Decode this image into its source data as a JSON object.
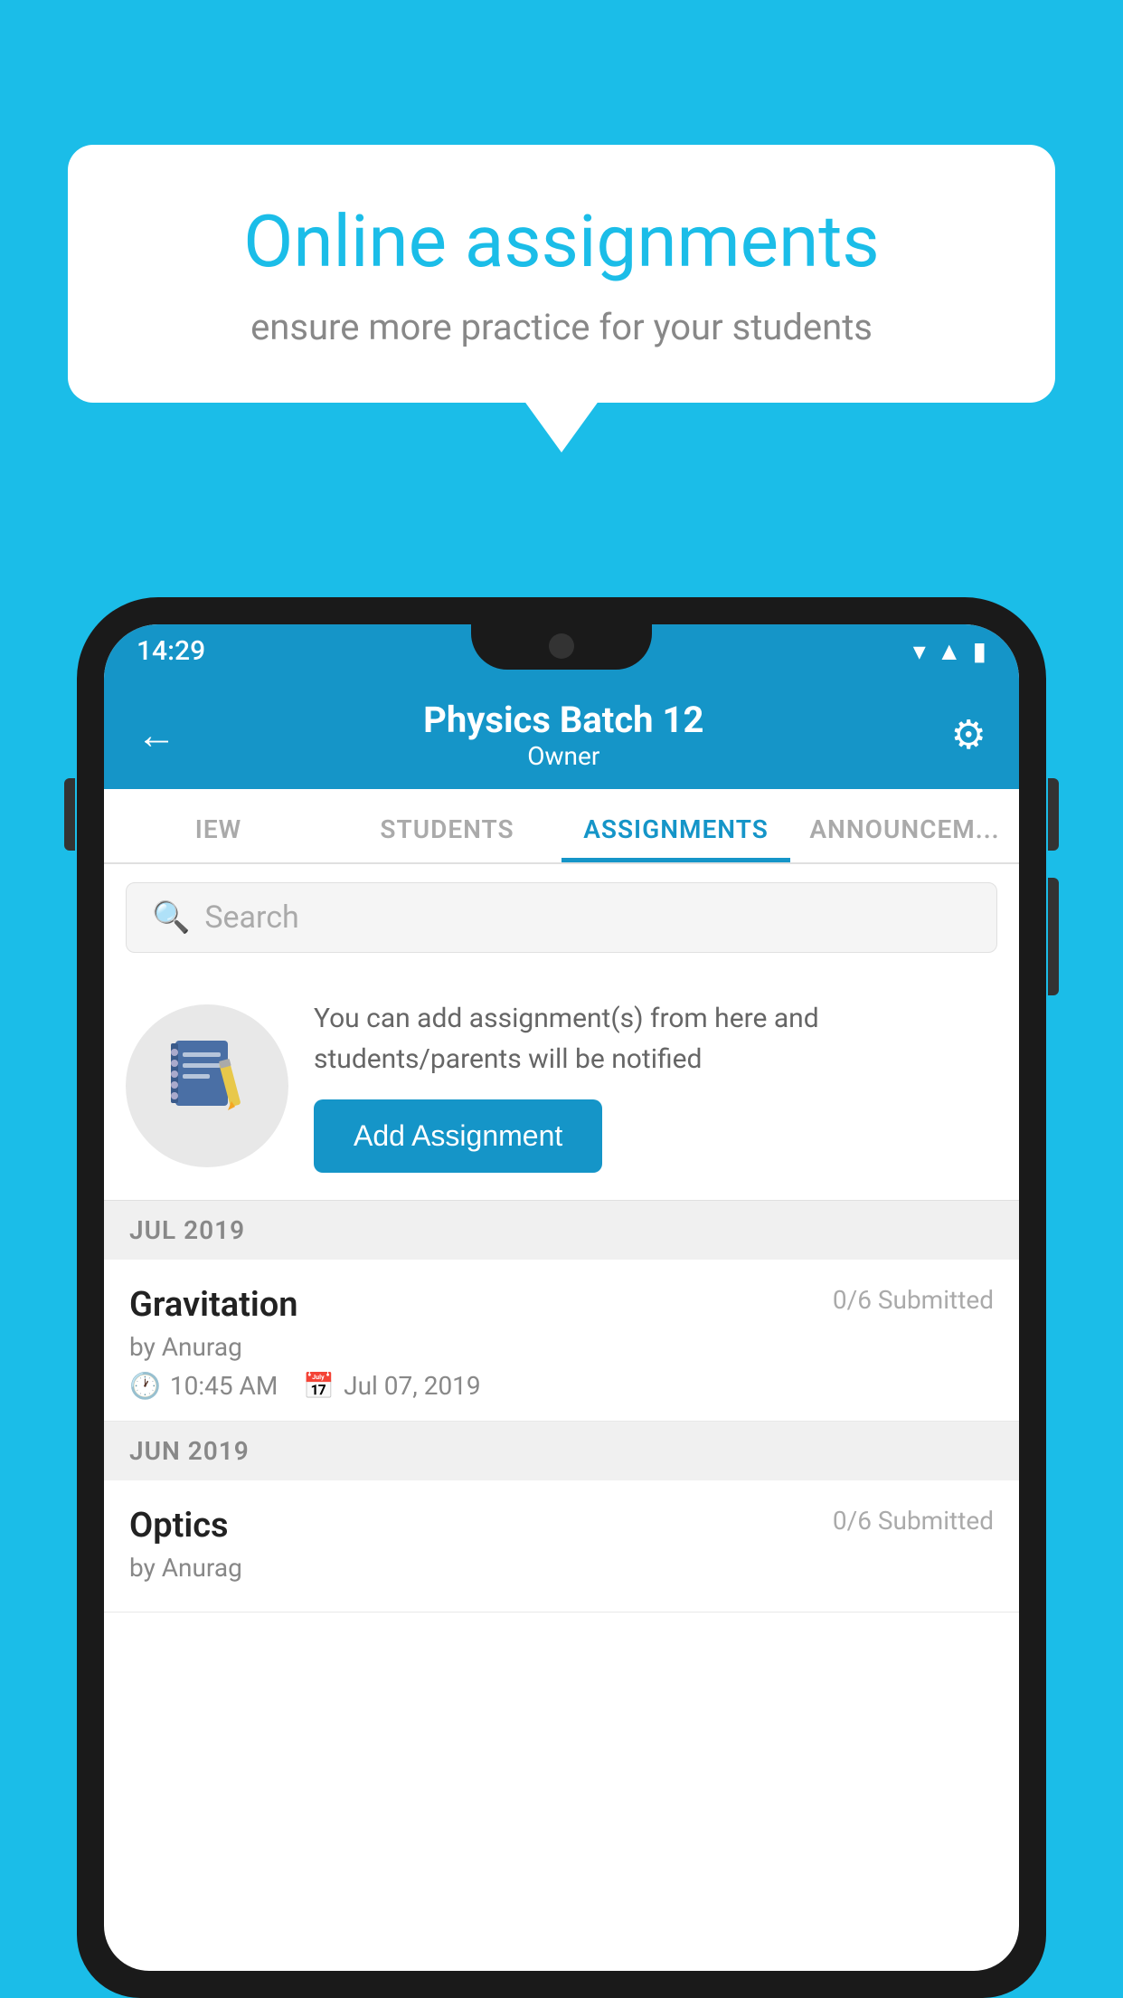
{
  "speech_bubble": {
    "title": "Online assignments",
    "subtitle": "ensure more practice for your students"
  },
  "phone": {
    "status_bar": {
      "time": "14:29",
      "icons": [
        "wifi",
        "signal",
        "battery"
      ]
    },
    "header": {
      "title": "Physics Batch 12",
      "subtitle": "Owner",
      "back_label": "←",
      "settings_label": "⚙"
    },
    "tabs": [
      {
        "label": "IEW",
        "active": false
      },
      {
        "label": "STUDENTS",
        "active": false
      },
      {
        "label": "ASSIGNMENTS",
        "active": true
      },
      {
        "label": "ANNOUNCEM...",
        "active": false
      }
    ],
    "search": {
      "placeholder": "Search"
    },
    "promo": {
      "text": "You can add assignment(s) from here and students/parents will be notified",
      "button_label": "Add Assignment"
    },
    "sections": [
      {
        "month": "JUL 2019",
        "assignments": [
          {
            "name": "Gravitation",
            "submitted": "0/6 Submitted",
            "author": "by Anurag",
            "time": "10:45 AM",
            "date": "Jul 07, 2019"
          }
        ]
      },
      {
        "month": "JUN 2019",
        "assignments": [
          {
            "name": "Optics",
            "submitted": "0/6 Submitted",
            "author": "by Anurag",
            "time": "",
            "date": ""
          }
        ]
      }
    ]
  }
}
